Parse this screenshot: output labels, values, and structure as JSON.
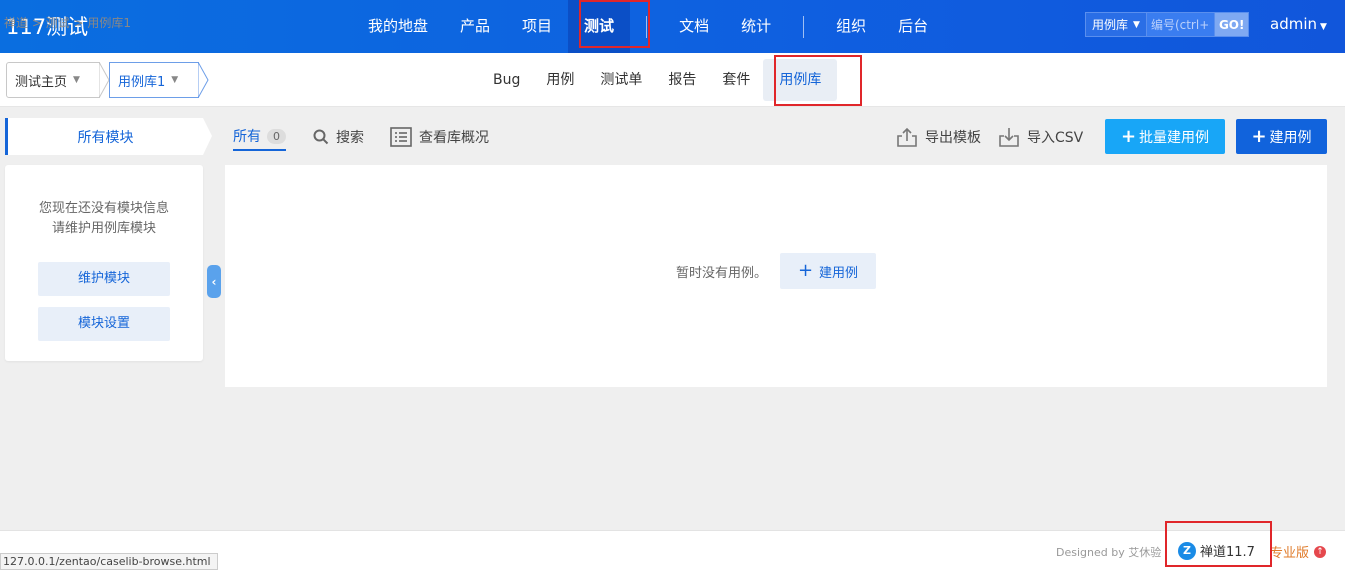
{
  "header": {
    "brand": "117测试",
    "nav": [
      {
        "label": "我的地盘"
      },
      {
        "label": "产品"
      },
      {
        "label": "项目"
      },
      {
        "label": "测试",
        "active": true
      },
      {
        "label": "文档"
      },
      {
        "label": "统计"
      },
      {
        "label": "组织"
      },
      {
        "label": "后台"
      }
    ],
    "search_type": "用例库",
    "search_placeholder": "编号(ctrl+g)",
    "search_go": "GO!",
    "user": "admin"
  },
  "subbar": {
    "crumb_home": "测试主页",
    "crumb_lib": "用例库1",
    "nav": [
      {
        "label": "Bug"
      },
      {
        "label": "用例"
      },
      {
        "label": "测试单"
      },
      {
        "label": "报告"
      },
      {
        "label": "套件"
      },
      {
        "label": "用例库",
        "active": true
      }
    ]
  },
  "sidebar": {
    "title": "所有模块",
    "empty_line1": "您现在还没有模块信息",
    "empty_line2": "请维护用例库模块",
    "btn_maintain": "维护模块",
    "btn_settings": "模块设置"
  },
  "toolbar": {
    "all_label": "所有",
    "all_count": "0",
    "search_label": "搜索",
    "view_label": "查看库概况",
    "export_label": "导出模板",
    "import_label": "导入CSV",
    "batch_create_label": "批量建用例",
    "create_label": "建用例"
  },
  "main": {
    "empty_text": "暂时没有用例。",
    "empty_create_label": "建用例"
  },
  "footer": {
    "breadcrumb": "禅道 > 测试 > 用例库1",
    "status_url": "127.0.0.1/zentao/caselib-browse.html",
    "designed_by": "Designed by 艾休验",
    "zentao_version": "禅道11.7",
    "edition": "专业版"
  },
  "colors": {
    "primary": "#1565d8",
    "header_bg": "#0f5fe0",
    "annotation_red": "#e0262a",
    "batch_btn": "#18a6f7"
  }
}
